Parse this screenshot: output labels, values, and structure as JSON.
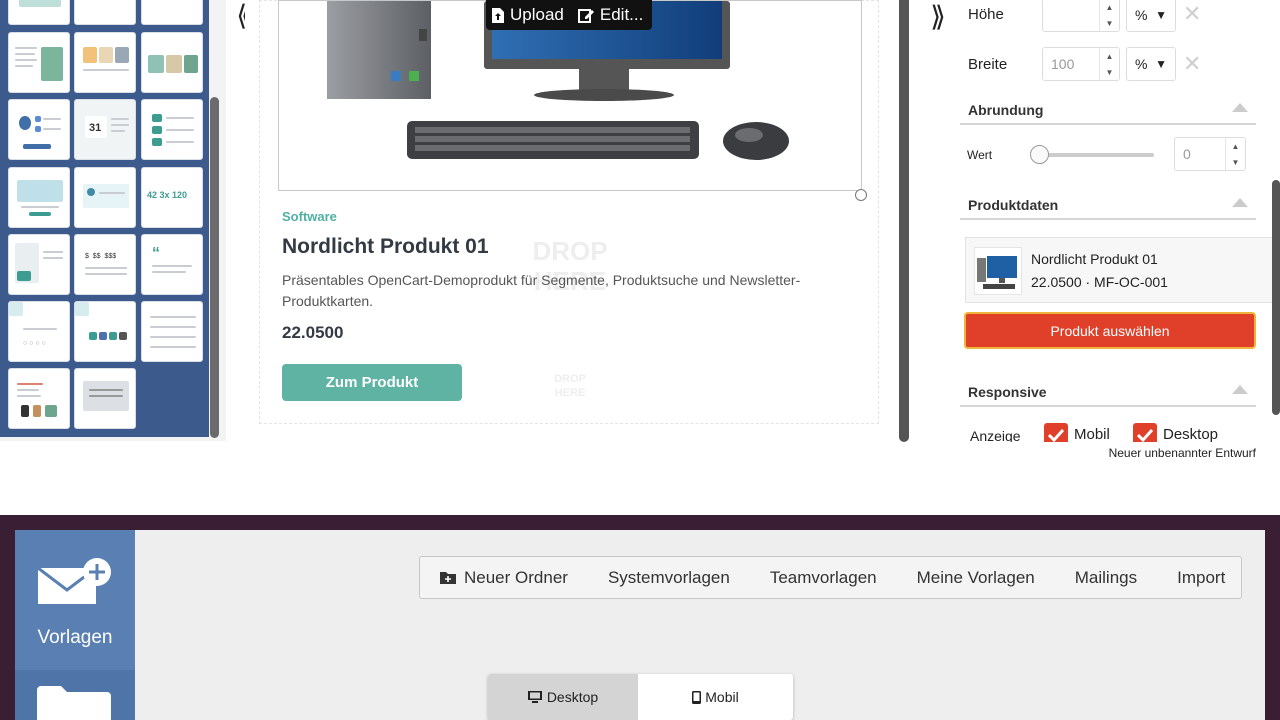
{
  "image_toolbar": {
    "upload_label": "Upload",
    "edit_label": "Edit..."
  },
  "ghost": {
    "drop_here": "DROP HERE"
  },
  "product": {
    "category": "Software",
    "title": "Nordlicht Produkt 01",
    "description": "Präsentables OpenCart-Demoprodukt für Segmente, Produktsuche und Newsletter-Produktkarten.",
    "price": "22.0500",
    "cta_label": "Zum Produkt"
  },
  "properties": {
    "height_label": "Höhe",
    "height_value": "",
    "height_unit": "%",
    "width_label": "Breite",
    "width_placeholder": "100",
    "width_unit": "%",
    "rounding_section": "Abrundung",
    "rounding_value_label": "Wert",
    "rounding_value": "0",
    "product_data_section": "Produktdaten",
    "selected_product_name": "Nordlicht Produkt 01",
    "selected_product_meta": "22.0500 · MF-OC-001",
    "select_product_button": "Produkt auswählen",
    "responsive_section": "Responsive",
    "display_label": "Anzeige",
    "mobile_checkbox": "Mobil",
    "desktop_checkbox": "Desktop"
  },
  "draft_name": "Neuer unbenannter Entwurf",
  "sidebar": {
    "templates_label": "Vorlagen"
  },
  "toolbar": {
    "new_folder": "Neuer Ordner",
    "system_templates": "Systemvorlagen",
    "team_templates": "Teamvorlagen",
    "my_templates": "Meine Vorlagen",
    "mailings": "Mailings",
    "import": "Import"
  },
  "device_toggle": {
    "desktop": "Desktop",
    "mobile": "Mobil"
  },
  "colors": {
    "accent_teal": "#5fb3a3",
    "danger_red": "#e0402a",
    "sidebar_blue": "#4e74a8",
    "app_bg_dark": "#3a1e33"
  }
}
